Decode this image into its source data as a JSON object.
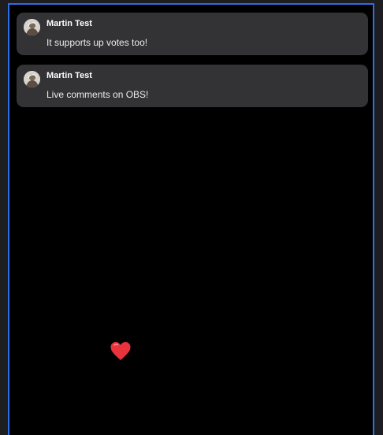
{
  "comments": [
    {
      "author": "Martin Test",
      "text": "It supports up votes too!",
      "avatar_icon": "avatar-icon"
    },
    {
      "author": "Martin Test",
      "text": "Live comments on OBS!",
      "avatar_icon": "avatar-icon"
    }
  ],
  "reaction": {
    "icon": "heart-icon",
    "color": "#e8323c"
  },
  "theme": {
    "background": "#000000",
    "card_background": "#333336",
    "frame_border": "#2b6ee8"
  }
}
